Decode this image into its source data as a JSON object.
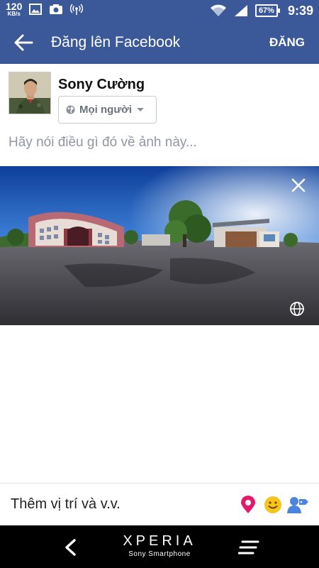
{
  "status_bar": {
    "net_speed_value": "120",
    "net_speed_unit": "KB/s",
    "battery": "67%",
    "time": "9:39",
    "icons": [
      "gallery-icon",
      "camera-icon",
      "hotspot-icon",
      "wifi-icon",
      "signal-icon",
      "battery-icon"
    ]
  },
  "app_bar": {
    "title": "Đăng lên Facebook",
    "post_label": "ĐĂNG"
  },
  "composer": {
    "user_name": "Sony Cường",
    "audience_label": "Mọi người",
    "prompt_placeholder": "Hãy nói điều gì đó về ảnh này..."
  },
  "bottom_bar": {
    "add_location_label": "Thêm vị trí và v.v.",
    "colors": {
      "location": "#e6186b",
      "feeling": "#f7c31d",
      "tag": "#4a83e0"
    }
  },
  "nav_bar": {
    "brand": "XPERIA",
    "brand_sub": "Sony Smartphone"
  },
  "colors": {
    "facebook_blue": "#3b5998",
    "text_dark": "#111111",
    "placeholder": "#9097a3"
  }
}
